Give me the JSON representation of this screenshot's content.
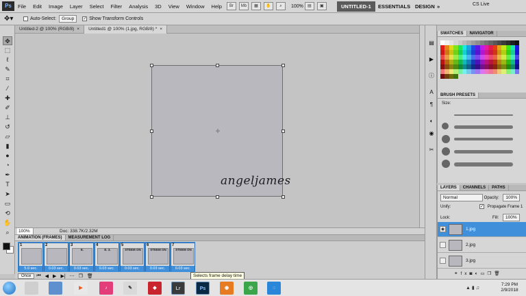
{
  "menubar": {
    "logo": "Ps",
    "items": [
      "File",
      "Edit",
      "Image",
      "Layer",
      "Select",
      "Filter",
      "Analysis",
      "3D",
      "View",
      "Window",
      "Help"
    ],
    "zoom": "100%",
    "workspaces": [
      "UNTITLED-1",
      "ESSENTIALS",
      "DESIGN"
    ],
    "active_workspace": "UNTITLED-1",
    "more": "»",
    "cs_live": "CS Live"
  },
  "options": {
    "auto_select_label": "Auto-Select:",
    "auto_select_value": "Group",
    "show_transform_label": "Show Transform Controls"
  },
  "documents": {
    "tabs": [
      {
        "label": "Untitled-2 @ 100% (RGB/8)"
      },
      {
        "label": "Untitled1 @ 100% (1.jpg, RGB/8) *"
      }
    ],
    "canvas_text": "angeljames"
  },
  "status": {
    "zoom": "100%",
    "doc_info": "Doc: 338.7K/2.32M"
  },
  "animation": {
    "tabs": [
      "ANIMATION (FRAMES)",
      "MEASUREMENT LOG"
    ],
    "frames": [
      {
        "num": "1",
        "delay": "5.0 sec.",
        "text": ""
      },
      {
        "num": "2",
        "delay": "0.03 sec.",
        "text": ""
      },
      {
        "num": "3",
        "delay": "0.03 sec.",
        "text": "E."
      },
      {
        "num": "4",
        "delay": "0.03 sec.",
        "text": "E. 3."
      },
      {
        "num": "5",
        "delay": "0.03 sec.",
        "text": "STEEM ON"
      },
      {
        "num": "6",
        "delay": "0.03 sec.",
        "text": "STEEM ON"
      },
      {
        "num": "7",
        "delay": "0.03 sec.",
        "text": "STEEM ON"
      }
    ],
    "loop": "Once",
    "tooltip": "Selects frame delay time"
  },
  "panels": {
    "swatches_tabs": [
      "SWATCHES",
      "NAVIGATOR"
    ],
    "brush_tab": "BRUSH PRESETS",
    "brush_size_label": "Size:",
    "layers_tabs": [
      "LAYERS",
      "CHANNELS",
      "PATHS"
    ],
    "blend_mode": "Normal",
    "opacity_label": "Opacity:",
    "opacity_value": "100%",
    "unify_label": "Unify:",
    "propagate_label": "Propagate Frame 1",
    "lock_label": "Lock:",
    "fill_label": "Fill:",
    "fill_value": "100%",
    "layers": [
      {
        "name": "1.jpg",
        "selected": true
      },
      {
        "name": "2.jpg",
        "selected": false
      },
      {
        "name": "3.jpg",
        "selected": false
      }
    ]
  },
  "taskbar": {
    "time": "7:29 PM",
    "date": "2/9/2018",
    "apps": [
      "lr-icon",
      "ps-icon"
    ],
    "lr_label": "Lr",
    "ps_label": "Ps"
  },
  "colors": {
    "accent": "#3f8fdb",
    "canvas": "#b9b8bf"
  }
}
